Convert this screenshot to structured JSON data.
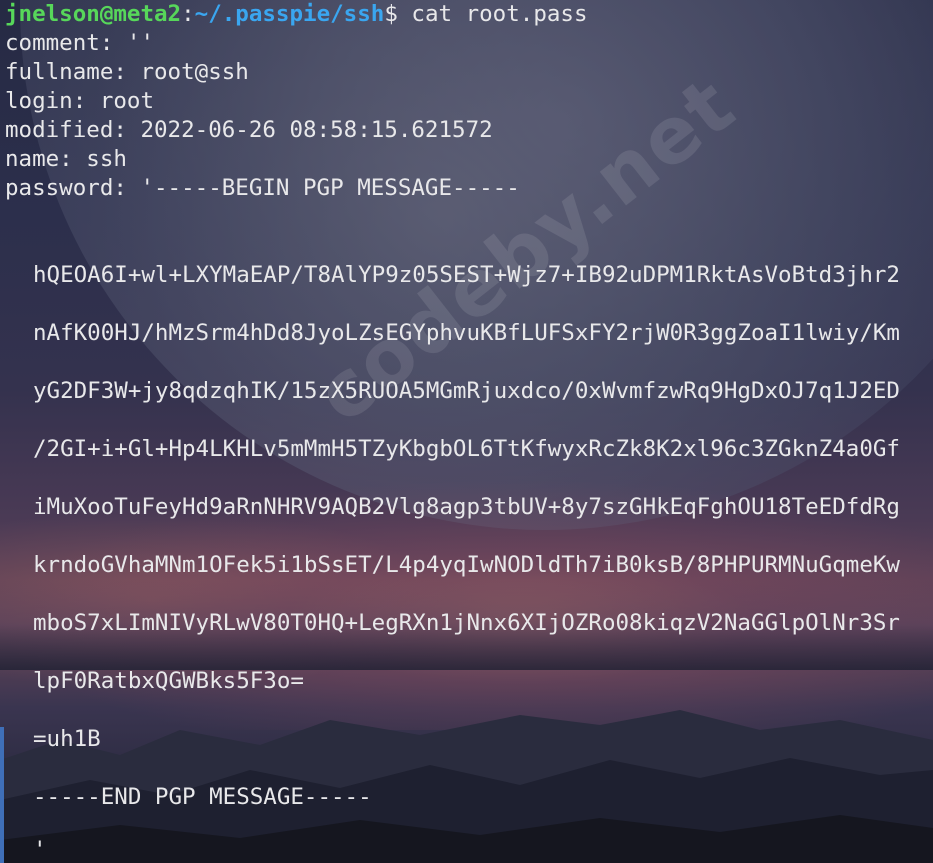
{
  "prompt": {
    "user_host": "jnelson@meta2",
    "colon": ":",
    "path": "~/.passpie/ssh",
    "symbol": "$",
    "command": " cat root.pass"
  },
  "fields": [
    "comment: ''",
    "fullname: root@ssh",
    "login: root",
    "modified: 2022-06-26 08:58:15.621572",
    "name: ssh",
    "password: '-----BEGIN PGP MESSAGE-----"
  ],
  "pgp_lines": [
    "hQEOA6I+wl+LXYMaEAP/T8AlYP9z05SEST+Wjz7+IB92uDPM1RktAsVoBtd3jhr2",
    "nAfK00HJ/hMzSrm4hDd8JyoLZsEGYphvuKBfLUFSxFY2rjW0R3ggZoaI1lwiy/Km",
    "yG2DF3W+jy8qdzqhIK/15zX5RUOA5MGmRjuxdco/0xWvmfzwRq9HgDxOJ7q1J2ED",
    "/2GI+i+Gl+Hp4LKHLv5mMmH5TZyKbgbOL6TtKfwyxRcZk8K2xl96c3ZGknZ4a0Gf",
    "iMuXooTuFeyHd9aRnNHRV9AQB2Vlg8agp3tbUV+8y7szGHkEqFghOU18TeEDfdRg",
    "krndoGVhaMNm1OFek5i1bSsET/L4p4yqIwNODldTh7iB0ksB/8PHPURMNuGqmeKw",
    "mboS7xLImNIVyRLwV80T0HQ+LegRXn1jNnx6XIjOZRo08kiqzV2NaGGlpOlNr3Sr",
    "lpF0RatbxQGWBks5F3o=",
    "=uh1B",
    "-----END PGP MESSAGE-----",
    "'"
  ],
  "watermark": "codeby.net"
}
